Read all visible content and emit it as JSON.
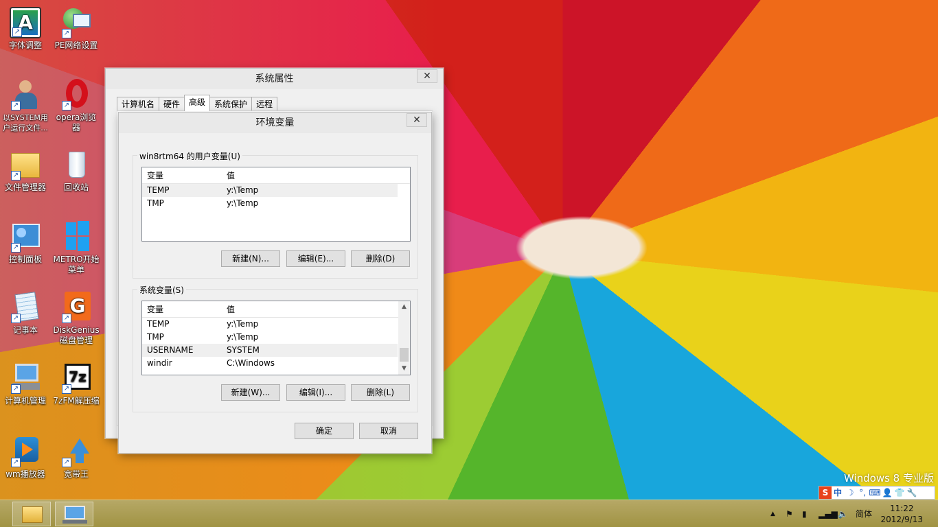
{
  "desktop": {
    "icons": [
      {
        "label": "字体调整",
        "icon": "font-a-icon"
      },
      {
        "label": "PE网络设置",
        "icon": "network-globe-icon"
      },
      {
        "label": "以SYSTEM用户运行文件...",
        "icon": "user-run-icon"
      },
      {
        "label": "opera浏览器",
        "icon": "opera-icon"
      },
      {
        "label": "文件管理器",
        "icon": "folder-icon"
      },
      {
        "label": "回收站",
        "icon": "recycle-bin-icon"
      },
      {
        "label": "控制面板",
        "icon": "control-panel-icon"
      },
      {
        "label": "METRO开始菜单",
        "icon": "windows-logo-icon"
      },
      {
        "label": "记事本",
        "icon": "notepad-icon"
      },
      {
        "label": "DiskGenius磁盘管理",
        "icon": "diskgenius-icon"
      },
      {
        "label": "计算机管理",
        "icon": "computer-management-icon"
      },
      {
        "label": "7zFM解压缩",
        "icon": "7zip-icon"
      },
      {
        "label": "wm播放器",
        "icon": "media-player-icon"
      },
      {
        "label": "宽带王",
        "icon": "broadband-icon"
      }
    ]
  },
  "sys_props": {
    "title": "系统属性",
    "close": "✕",
    "tabs": [
      "计算机名",
      "硬件",
      "高级",
      "系统保护",
      "远程"
    ]
  },
  "env_dialog": {
    "title": "环境变量",
    "close": "✕",
    "user_group_title": "win8rtm64 的用户变量(U)",
    "columns": [
      "变量",
      "值"
    ],
    "user_vars": [
      {
        "name": "TEMP",
        "value": "y:\\Temp"
      },
      {
        "name": "TMP",
        "value": "y:\\Temp"
      }
    ],
    "user_buttons": {
      "new": "新建(N)...",
      "edit": "编辑(E)...",
      "delete": "删除(D)"
    },
    "sys_group_title": "系统变量(S)",
    "sys_vars": [
      {
        "name": "TEMP",
        "value": "y:\\Temp"
      },
      {
        "name": "TMP",
        "value": "y:\\Temp"
      },
      {
        "name": "USERNAME",
        "value": "SYSTEM"
      },
      {
        "name": "windir",
        "value": "C:\\Windows"
      }
    ],
    "sys_buttons": {
      "new": "新建(W)...",
      "edit": "编辑(I)...",
      "delete": "删除(L)"
    },
    "ok": "确定",
    "cancel": "取消"
  },
  "watermark": "Windows 8 专业版",
  "ime_bar": [
    "S",
    "中",
    "☽",
    "°,",
    "⌨",
    "👤",
    "👕",
    "🔧"
  ],
  "taskbar": {
    "lang": "简体",
    "time": "11:22",
    "date": "2012/9/13"
  }
}
